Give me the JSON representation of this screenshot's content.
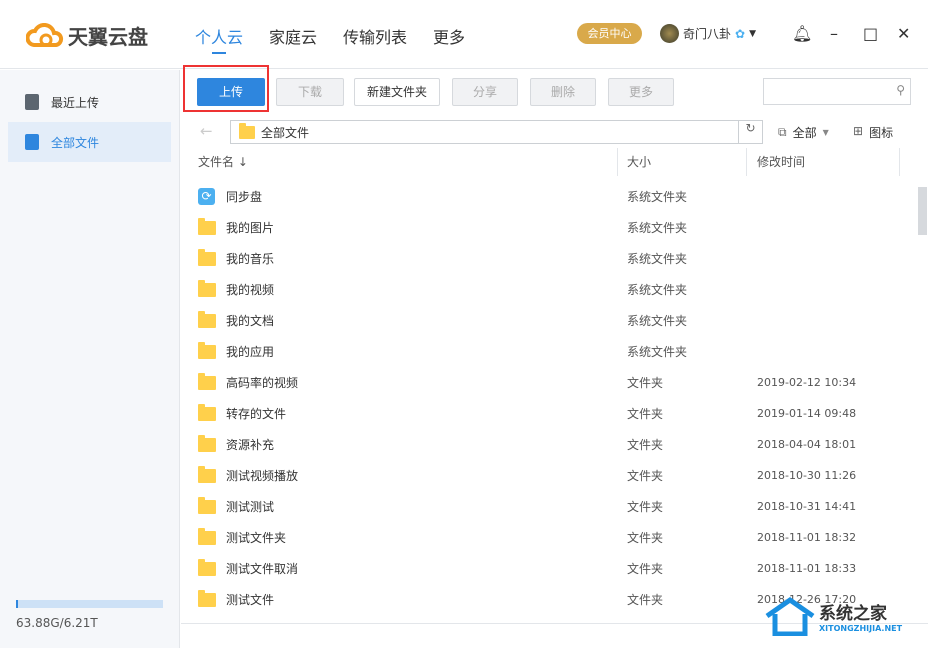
{
  "header": {
    "logo": "天翼云盘",
    "nav": [
      "个人云",
      "家庭云",
      "传输列表",
      "更多"
    ],
    "vip": "会员中心",
    "user": "奇门八卦"
  },
  "sidebar": {
    "items": [
      "最近上传",
      "全部文件"
    ],
    "storage": "63.88G/6.21T",
    "storage_fraction": 0.01
  },
  "toolbar": {
    "upload": "上传",
    "download": "下载",
    "new_folder": "新建文件夹",
    "share": "分享",
    "delete": "删除",
    "more": "更多",
    "search_placeholder": ""
  },
  "path": {
    "current": "全部文件",
    "filter": "全部",
    "view": "图标"
  },
  "columns": {
    "name": "文件名 ↓",
    "size": "大小",
    "mtime": "修改时间"
  },
  "files": [
    {
      "name": "同步盘",
      "type": "系统文件夹",
      "time": "",
      "icon": "sync"
    },
    {
      "name": "我的图片",
      "type": "系统文件夹",
      "time": ""
    },
    {
      "name": "我的音乐",
      "type": "系统文件夹",
      "time": ""
    },
    {
      "name": "我的视频",
      "type": "系统文件夹",
      "time": ""
    },
    {
      "name": "我的文档",
      "type": "系统文件夹",
      "time": ""
    },
    {
      "name": "我的应用",
      "type": "系统文件夹",
      "time": ""
    },
    {
      "name": "高码率的视频",
      "type": "文件夹",
      "time": "2019-02-12 10:34"
    },
    {
      "name": "转存的文件",
      "type": "文件夹",
      "time": "2019-01-14 09:48"
    },
    {
      "name": "资源补充",
      "type": "文件夹",
      "time": "2018-04-04 18:01"
    },
    {
      "name": "测试视频播放",
      "type": "文件夹",
      "time": "2018-10-30 11:26"
    },
    {
      "name": "测试测试",
      "type": "文件夹",
      "time": "2018-10-31 14:41"
    },
    {
      "name": "测试文件夹",
      "type": "文件夹",
      "time": "2018-11-01 18:32"
    },
    {
      "name": "测试文件取消",
      "type": "文件夹",
      "time": "2018-11-01 18:33"
    },
    {
      "name": "测试文件",
      "type": "文件夹",
      "time": "2018-12-26 17:20"
    }
  ],
  "watermark": {
    "title": "系统之家",
    "url": "XITONGZHIJIA.NET"
  }
}
